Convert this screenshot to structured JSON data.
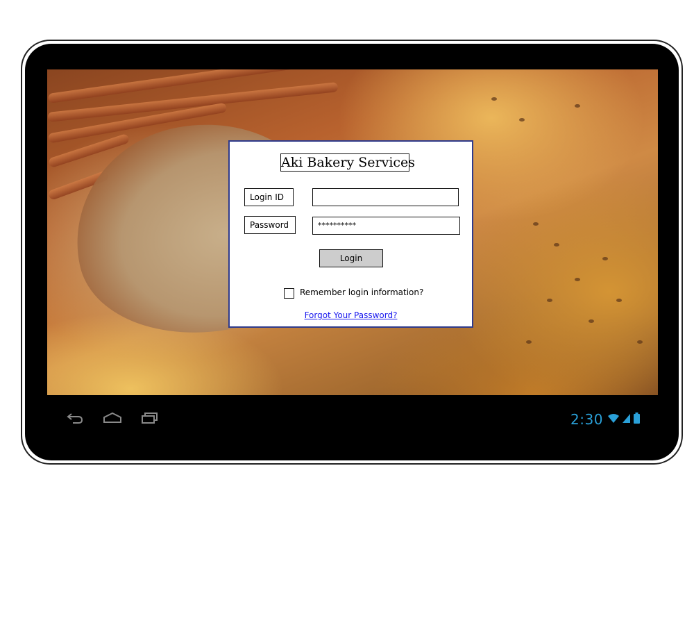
{
  "login_form": {
    "title": "Aki Bakery Services",
    "login_id_label": "Login ID",
    "login_id_value": "",
    "password_label": "Password",
    "password_value": "**********",
    "login_button": "Login",
    "remember_label": "Remember login information?",
    "remember_checked": false,
    "forgot_link": "Forgot Your Password?"
  },
  "status_bar": {
    "time": "2:30",
    "icons": [
      "wifi-icon",
      "signal-icon",
      "battery-icon"
    ],
    "accent_color": "#2aa0d8"
  },
  "nav_bar": {
    "icons": [
      "back-icon",
      "home-icon",
      "recent-apps-icon"
    ]
  },
  "colors": {
    "card_border": "#2e3a8c",
    "link": "#1a1aee",
    "button_bg": "#cdcdcd"
  }
}
